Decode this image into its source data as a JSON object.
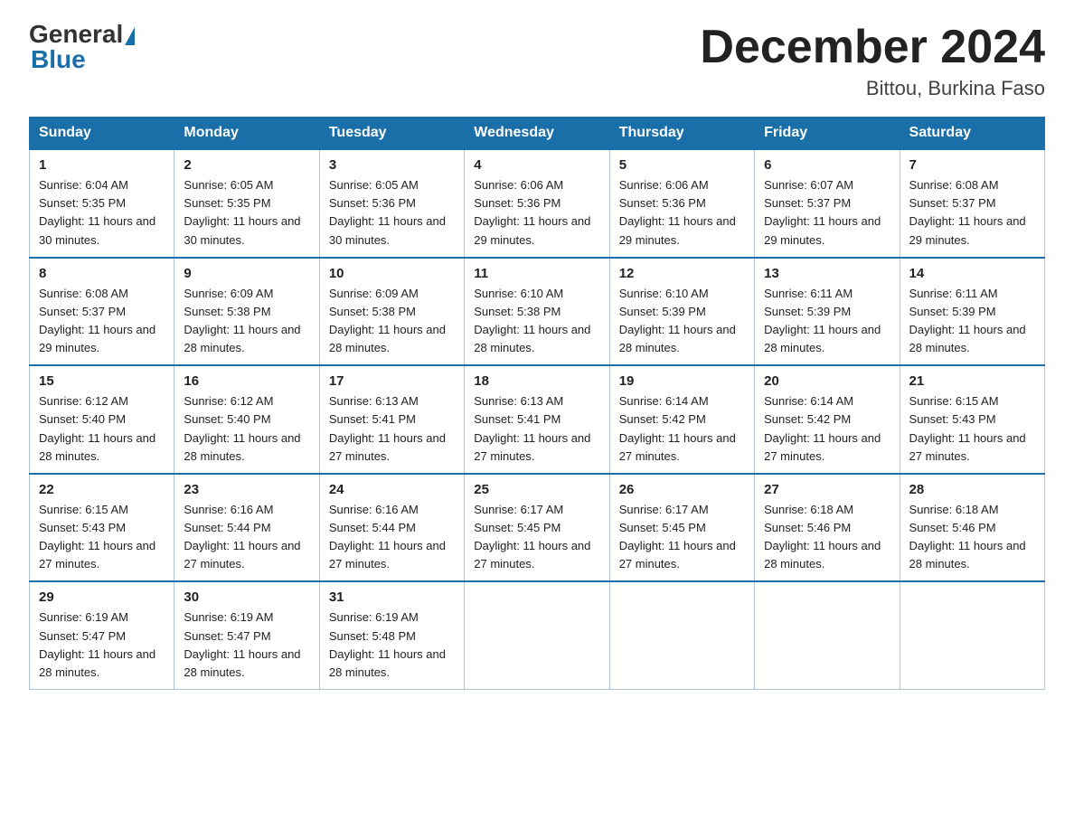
{
  "logo": {
    "text1": "General",
    "text2": "Blue"
  },
  "title": "December 2024",
  "location": "Bittou, Burkina Faso",
  "weekdays": [
    "Sunday",
    "Monday",
    "Tuesday",
    "Wednesday",
    "Thursday",
    "Friday",
    "Saturday"
  ],
  "weeks": [
    [
      {
        "day": "1",
        "sunrise": "6:04 AM",
        "sunset": "5:35 PM",
        "daylight": "11 hours and 30 minutes."
      },
      {
        "day": "2",
        "sunrise": "6:05 AM",
        "sunset": "5:35 PM",
        "daylight": "11 hours and 30 minutes."
      },
      {
        "day": "3",
        "sunrise": "6:05 AM",
        "sunset": "5:36 PM",
        "daylight": "11 hours and 30 minutes."
      },
      {
        "day": "4",
        "sunrise": "6:06 AM",
        "sunset": "5:36 PM",
        "daylight": "11 hours and 29 minutes."
      },
      {
        "day": "5",
        "sunrise": "6:06 AM",
        "sunset": "5:36 PM",
        "daylight": "11 hours and 29 minutes."
      },
      {
        "day": "6",
        "sunrise": "6:07 AM",
        "sunset": "5:37 PM",
        "daylight": "11 hours and 29 minutes."
      },
      {
        "day": "7",
        "sunrise": "6:08 AM",
        "sunset": "5:37 PM",
        "daylight": "11 hours and 29 minutes."
      }
    ],
    [
      {
        "day": "8",
        "sunrise": "6:08 AM",
        "sunset": "5:37 PM",
        "daylight": "11 hours and 29 minutes."
      },
      {
        "day": "9",
        "sunrise": "6:09 AM",
        "sunset": "5:38 PM",
        "daylight": "11 hours and 28 minutes."
      },
      {
        "day": "10",
        "sunrise": "6:09 AM",
        "sunset": "5:38 PM",
        "daylight": "11 hours and 28 minutes."
      },
      {
        "day": "11",
        "sunrise": "6:10 AM",
        "sunset": "5:38 PM",
        "daylight": "11 hours and 28 minutes."
      },
      {
        "day": "12",
        "sunrise": "6:10 AM",
        "sunset": "5:39 PM",
        "daylight": "11 hours and 28 minutes."
      },
      {
        "day": "13",
        "sunrise": "6:11 AM",
        "sunset": "5:39 PM",
        "daylight": "11 hours and 28 minutes."
      },
      {
        "day": "14",
        "sunrise": "6:11 AM",
        "sunset": "5:39 PM",
        "daylight": "11 hours and 28 minutes."
      }
    ],
    [
      {
        "day": "15",
        "sunrise": "6:12 AM",
        "sunset": "5:40 PM",
        "daylight": "11 hours and 28 minutes."
      },
      {
        "day": "16",
        "sunrise": "6:12 AM",
        "sunset": "5:40 PM",
        "daylight": "11 hours and 28 minutes."
      },
      {
        "day": "17",
        "sunrise": "6:13 AM",
        "sunset": "5:41 PM",
        "daylight": "11 hours and 27 minutes."
      },
      {
        "day": "18",
        "sunrise": "6:13 AM",
        "sunset": "5:41 PM",
        "daylight": "11 hours and 27 minutes."
      },
      {
        "day": "19",
        "sunrise": "6:14 AM",
        "sunset": "5:42 PM",
        "daylight": "11 hours and 27 minutes."
      },
      {
        "day": "20",
        "sunrise": "6:14 AM",
        "sunset": "5:42 PM",
        "daylight": "11 hours and 27 minutes."
      },
      {
        "day": "21",
        "sunrise": "6:15 AM",
        "sunset": "5:43 PM",
        "daylight": "11 hours and 27 minutes."
      }
    ],
    [
      {
        "day": "22",
        "sunrise": "6:15 AM",
        "sunset": "5:43 PM",
        "daylight": "11 hours and 27 minutes."
      },
      {
        "day": "23",
        "sunrise": "6:16 AM",
        "sunset": "5:44 PM",
        "daylight": "11 hours and 27 minutes."
      },
      {
        "day": "24",
        "sunrise": "6:16 AM",
        "sunset": "5:44 PM",
        "daylight": "11 hours and 27 minutes."
      },
      {
        "day": "25",
        "sunrise": "6:17 AM",
        "sunset": "5:45 PM",
        "daylight": "11 hours and 27 minutes."
      },
      {
        "day": "26",
        "sunrise": "6:17 AM",
        "sunset": "5:45 PM",
        "daylight": "11 hours and 27 minutes."
      },
      {
        "day": "27",
        "sunrise": "6:18 AM",
        "sunset": "5:46 PM",
        "daylight": "11 hours and 28 minutes."
      },
      {
        "day": "28",
        "sunrise": "6:18 AM",
        "sunset": "5:46 PM",
        "daylight": "11 hours and 28 minutes."
      }
    ],
    [
      {
        "day": "29",
        "sunrise": "6:19 AM",
        "sunset": "5:47 PM",
        "daylight": "11 hours and 28 minutes."
      },
      {
        "day": "30",
        "sunrise": "6:19 AM",
        "sunset": "5:47 PM",
        "daylight": "11 hours and 28 minutes."
      },
      {
        "day": "31",
        "sunrise": "6:19 AM",
        "sunset": "5:48 PM",
        "daylight": "11 hours and 28 minutes."
      },
      null,
      null,
      null,
      null
    ]
  ]
}
